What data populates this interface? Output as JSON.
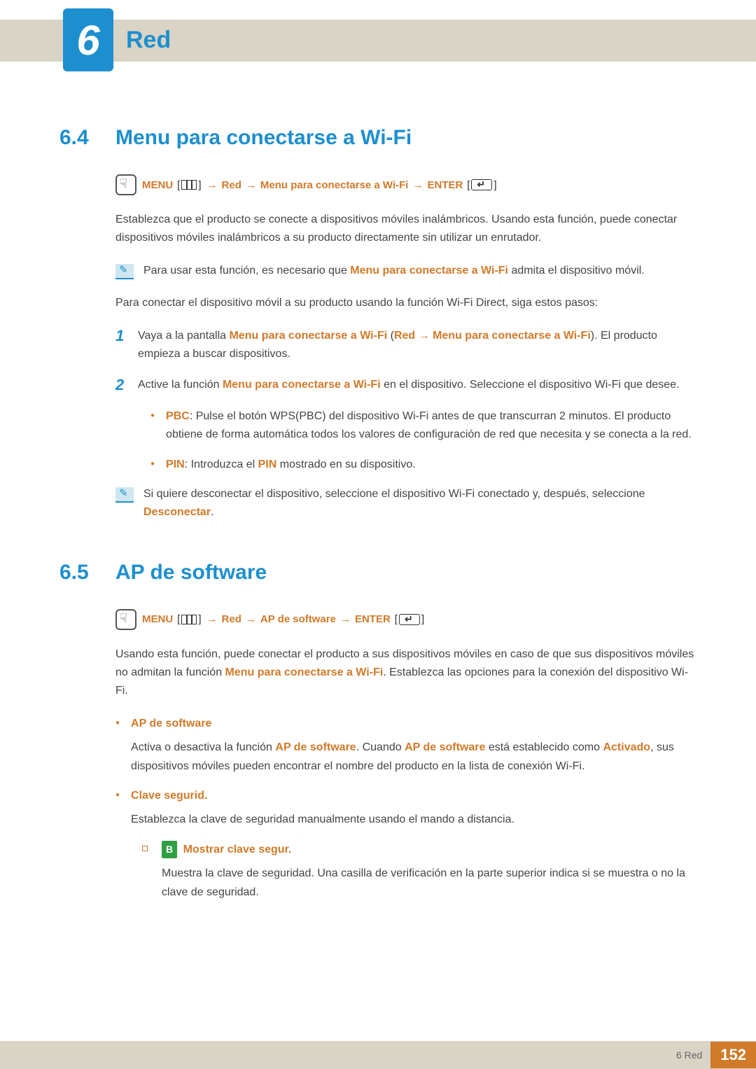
{
  "chapter": {
    "number": "6",
    "title": "Red"
  },
  "sections": [
    {
      "num": "6.4",
      "title": "Menu para conectarse a Wi-Fi",
      "path": {
        "menu": "MENU",
        "items": [
          "Red",
          "Menu para conectarse a Wi-Fi"
        ],
        "enter": "ENTER"
      },
      "intro": "Establezca que el producto se conecte a dispositivos móviles inalámbricos. Usando esta función, puede conectar dispositivos móviles inalámbricos a su producto directamente sin utilizar un enrutador.",
      "note1_pre": "Para usar esta función, es necesario que ",
      "note1_hl": "Menu para conectarse a Wi-Fi",
      "note1_post": " admita el dispositivo móvil.",
      "lead": "Para conectar el dispositivo móvil a su producto usando la función Wi-Fi Direct, siga estos pasos:",
      "steps": [
        {
          "n": "1",
          "pre": "Vaya a la pantalla ",
          "hl1": "Menu para conectarse a Wi-Fi",
          "mid1": " (",
          "hl2": "Red",
          "arrow": " → ",
          "hl3": "Menu para conectarse a Wi-Fi",
          "mid2": "). El producto empieza a buscar dispositivos."
        },
        {
          "n": "2",
          "pre": "Active la función ",
          "hl1": "Menu para conectarse a Wi-Fi",
          "post": " en el dispositivo. Seleccione el dispositivo Wi-Fi que desee."
        }
      ],
      "bullets_a": [
        {
          "label": "PBC",
          "text": ": Pulse el botón WPS(PBC) del dispositivo Wi-Fi antes de que transcurran 2 minutos. El producto obtiene de forma automática todos los valores de configuración de red que necesita y se conecta a la red."
        },
        {
          "label": "PIN",
          "pre": ": Introduzca el ",
          "hl": "PIN",
          "post": " mostrado en su dispositivo."
        }
      ],
      "note2_pre": "Si quiere desconectar el dispositivo, seleccione el dispositivo Wi-Fi conectado y, después, seleccione ",
      "note2_hl": "Desconectar",
      "note2_post": "."
    },
    {
      "num": "6.5",
      "title": "AP de software",
      "path": {
        "menu": "MENU",
        "items": [
          "Red",
          "AP de software"
        ],
        "enter": "ENTER"
      },
      "intro_pre": "Usando esta función, puede conectar el producto a sus dispositivos móviles en caso de que sus dispositivos móviles no admitan la función ",
      "intro_hl": "Menu para conectarse a Wi-Fi",
      "intro_post": ". Establezca las opciones para la conexión del dispositivo Wi-Fi.",
      "bullets": [
        {
          "title": "AP de software",
          "body_pre": "Activa o desactiva la función ",
          "hl1": "AP de software",
          "mid": ". Cuando ",
          "hl2": "AP de software",
          "mid2": " está establecido como ",
          "hl3": "Activado",
          "post": ", sus dispositivos móviles pueden encontrar el nombre del producto en la lista de conexión Wi-Fi."
        },
        {
          "title": "Clave segurid.",
          "body": "Establezca la clave de seguridad manualmente usando el mando a distancia."
        }
      ],
      "sub_bullet": {
        "badge": "B",
        "title": "Mostrar clave segur.",
        "body": "Muestra la clave de seguridad. Una casilla de verificación en la parte superior indica si se muestra o no la clave de seguridad."
      }
    }
  ],
  "footer": {
    "label": "6 Red",
    "page": "152"
  }
}
